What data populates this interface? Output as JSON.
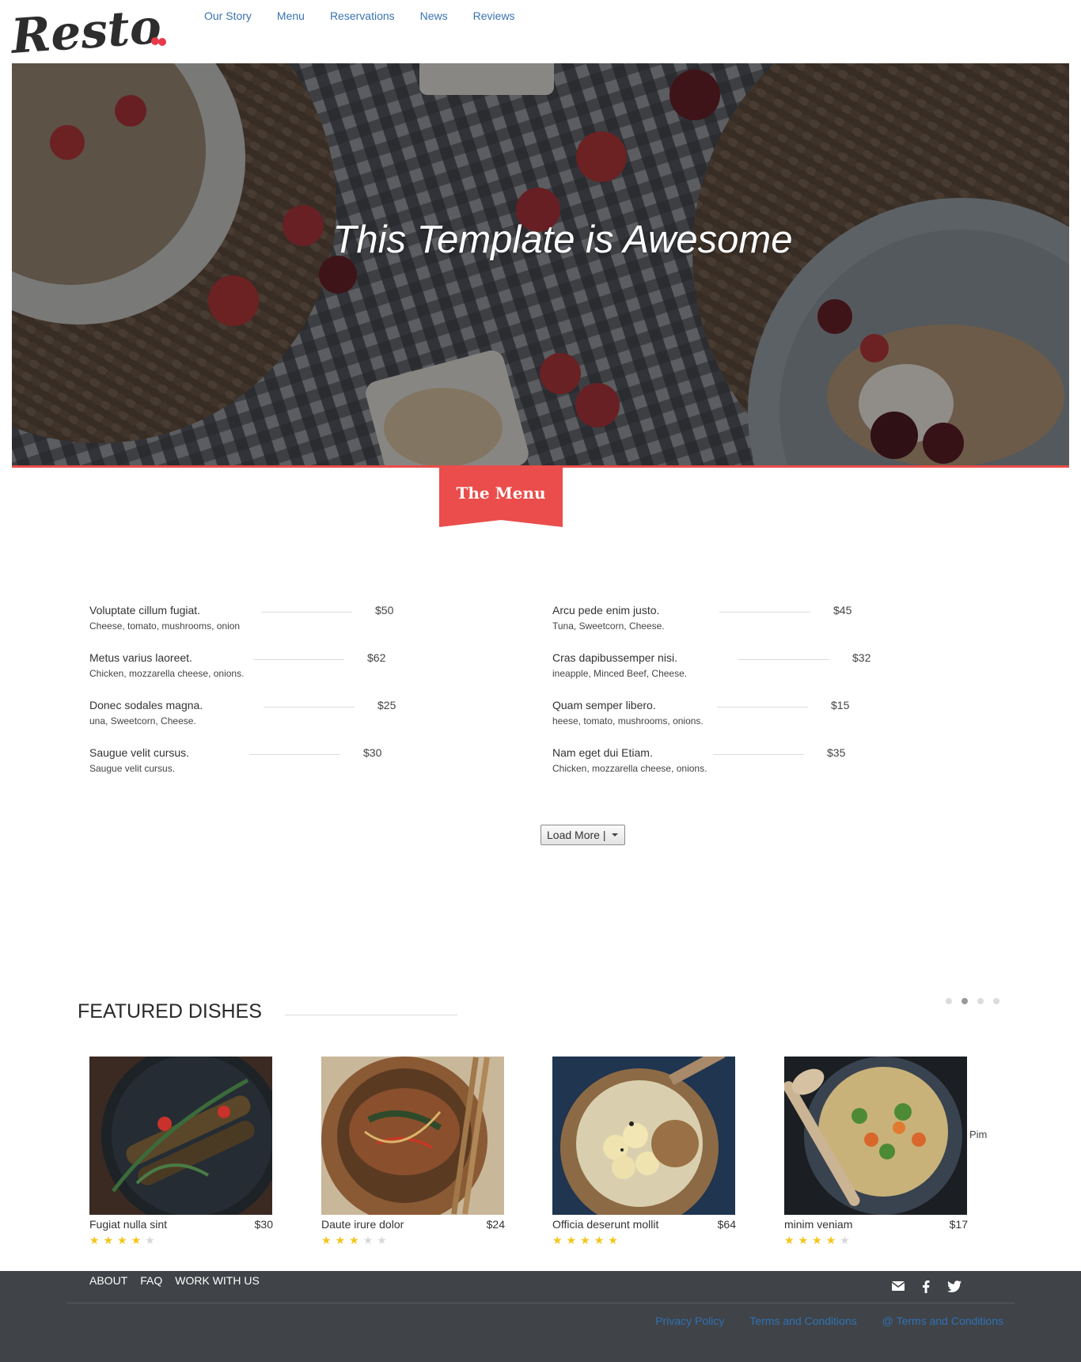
{
  "header": {
    "logo_text": "Resto",
    "nav": [
      "Our Story",
      "Menu",
      "Reservations",
      "News",
      "Reviews"
    ]
  },
  "hero": {
    "title": "This Template is Awesome"
  },
  "menu_section": {
    "label": "The Menu",
    "load_more": "Load More |",
    "left_items": [
      {
        "name": "Voluptate cillum fugiat.",
        "desc": "Cheese, tomato, mushrooms, onion",
        "price": "$50"
      },
      {
        "name": "Metus varius laoreet.",
        "desc": "Chicken, mozzarella cheese, onions.",
        "price": "$62"
      },
      {
        "name": "Donec sodales magna.",
        "desc": "una, Sweetcorn, Cheese.",
        "price": "$25"
      },
      {
        "name": "Saugue velit cursus.",
        "desc": "Saugue velit cursus.",
        "price": "$30"
      }
    ],
    "right_items": [
      {
        "name": "Arcu pede enim justo.",
        "desc": "Tuna, Sweetcorn, Cheese.",
        "price": "$45"
      },
      {
        "name": "Cras dapibussemper nisi.",
        "desc": "ineapple, Minced Beef, Cheese.",
        "price": "$32"
      },
      {
        "name": "Quam semper libero.",
        "desc": "heese, tomato, mushrooms, onions.",
        "price": "$15"
      },
      {
        "name": "Nam eget dui Etiam.",
        "desc": "Chicken, mozzarella cheese, onions.",
        "price": "$35"
      }
    ]
  },
  "featured": {
    "title": "FEATURED DISHES",
    "carousel_dots": 4,
    "active_dot": 1,
    "extra_label": "Pim",
    "dishes": [
      {
        "name": "Fugiat nulla sint",
        "price": "$30",
        "rating": 4
      },
      {
        "name": "Daute irure dolor",
        "price": "$24",
        "rating": 3
      },
      {
        "name": "Officia deserunt mollit",
        "price": "$64",
        "rating": 5
      },
      {
        "name": "minim veniam",
        "price": "$17",
        "rating": 4
      }
    ]
  },
  "footer": {
    "links": [
      "ABOUT",
      "FAQ",
      "WORK WITH US"
    ],
    "social": [
      "mail-icon",
      "facebook-icon",
      "twitter-icon"
    ],
    "legal": [
      "Privacy Policy",
      "Terms and Conditions",
      "@ Terms and Conditions"
    ]
  },
  "colors": {
    "accent": "#ea4d4b",
    "nav_link": "#3a73b2",
    "footer_bg": "#404347",
    "star": "#f5c518"
  }
}
